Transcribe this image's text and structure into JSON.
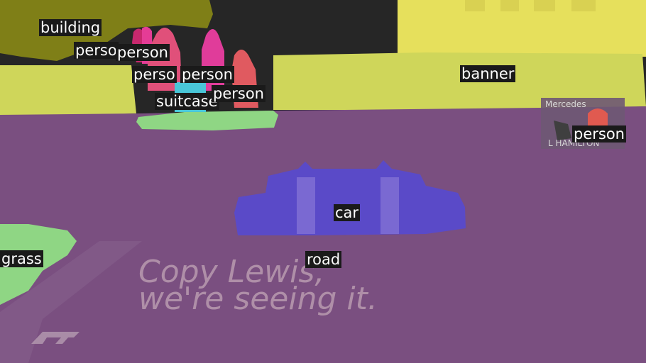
{
  "image": {
    "caption_lines": [
      "Copy Lewis,",
      "we're seeing it."
    ],
    "signage": [
      "Mercedes",
      "L HAMILTON"
    ]
  },
  "segments": [
    {
      "name": "building",
      "color": "#8a8a16"
    },
    {
      "name": "banner",
      "color": "#cfd65a"
    },
    {
      "name": "road",
      "color": "#7a4f80"
    },
    {
      "name": "car",
      "color": "#5a4ac8"
    },
    {
      "name": "grass",
      "color": "#8fd684"
    },
    {
      "name": "suitcase",
      "color": "#49c6d8"
    },
    {
      "name": "person",
      "color": "#e0507a"
    }
  ],
  "labels": {
    "building": "building",
    "banner": "banner",
    "road": "road",
    "car": "car",
    "grass": "grass",
    "suitcase": "suitcase",
    "person_1": "perso",
    "person_2": "person",
    "person_3": "perso",
    "person_4": "person",
    "person_5": "person",
    "person_6": "person"
  }
}
